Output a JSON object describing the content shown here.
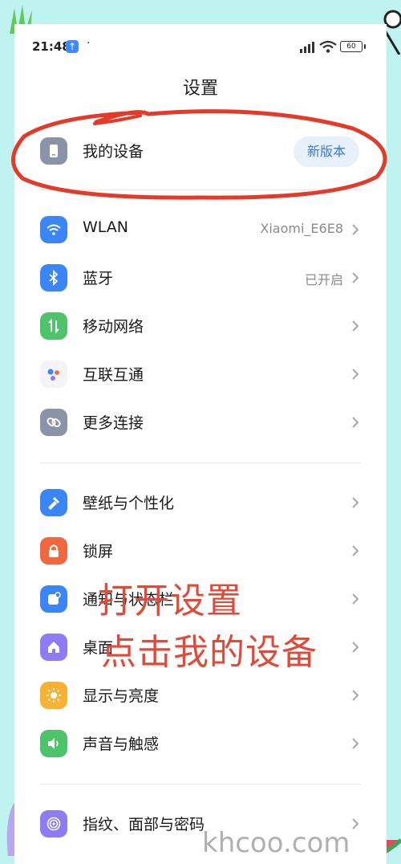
{
  "status_bar": {
    "time": "21:48",
    "dot": "·",
    "battery": "60"
  },
  "page_title": "设置",
  "my_device": {
    "label": "我的设备",
    "badge": "新版本"
  },
  "group1": [
    {
      "label": "WLAN",
      "value": "Xiaomi_E6E8",
      "icon": "wifi-icon",
      "color": "#3b86f7"
    },
    {
      "label": "蓝牙",
      "value": "已开启",
      "icon": "bluetooth-icon",
      "color": "#3b86f7"
    },
    {
      "label": "移动网络",
      "value": "",
      "icon": "mobile-network-icon",
      "color": "#4fc36a"
    },
    {
      "label": "互联互通",
      "value": "",
      "icon": "interconnect-icon",
      "color": "#f4f4f6"
    },
    {
      "label": "更多连接",
      "value": "",
      "icon": "link-icon",
      "color": "#8a93a8"
    }
  ],
  "group2": [
    {
      "label": "壁纸与个性化",
      "icon": "wallpaper-icon",
      "color": "#3b86f7"
    },
    {
      "label": "锁屏",
      "icon": "lock-icon",
      "color": "#f1683e"
    },
    {
      "label": "通知与状态栏",
      "icon": "notification-icon",
      "color": "#3b86f7"
    },
    {
      "label": "桌面",
      "icon": "home-icon",
      "color": "#8d7cf4"
    },
    {
      "label": "显示与亮度",
      "icon": "sun-icon",
      "color": "#f7b233"
    },
    {
      "label": "声音与触感",
      "icon": "sound-icon",
      "color": "#4fc36a"
    }
  ],
  "group3": [
    {
      "label": "指纹、面部与密码",
      "icon": "fingerprint-icon",
      "color": "#8d7cf4"
    }
  ],
  "annotation": {
    "line1": "打开设置",
    "line2": "点击我的设备"
  },
  "watermark": "khcoo.com"
}
